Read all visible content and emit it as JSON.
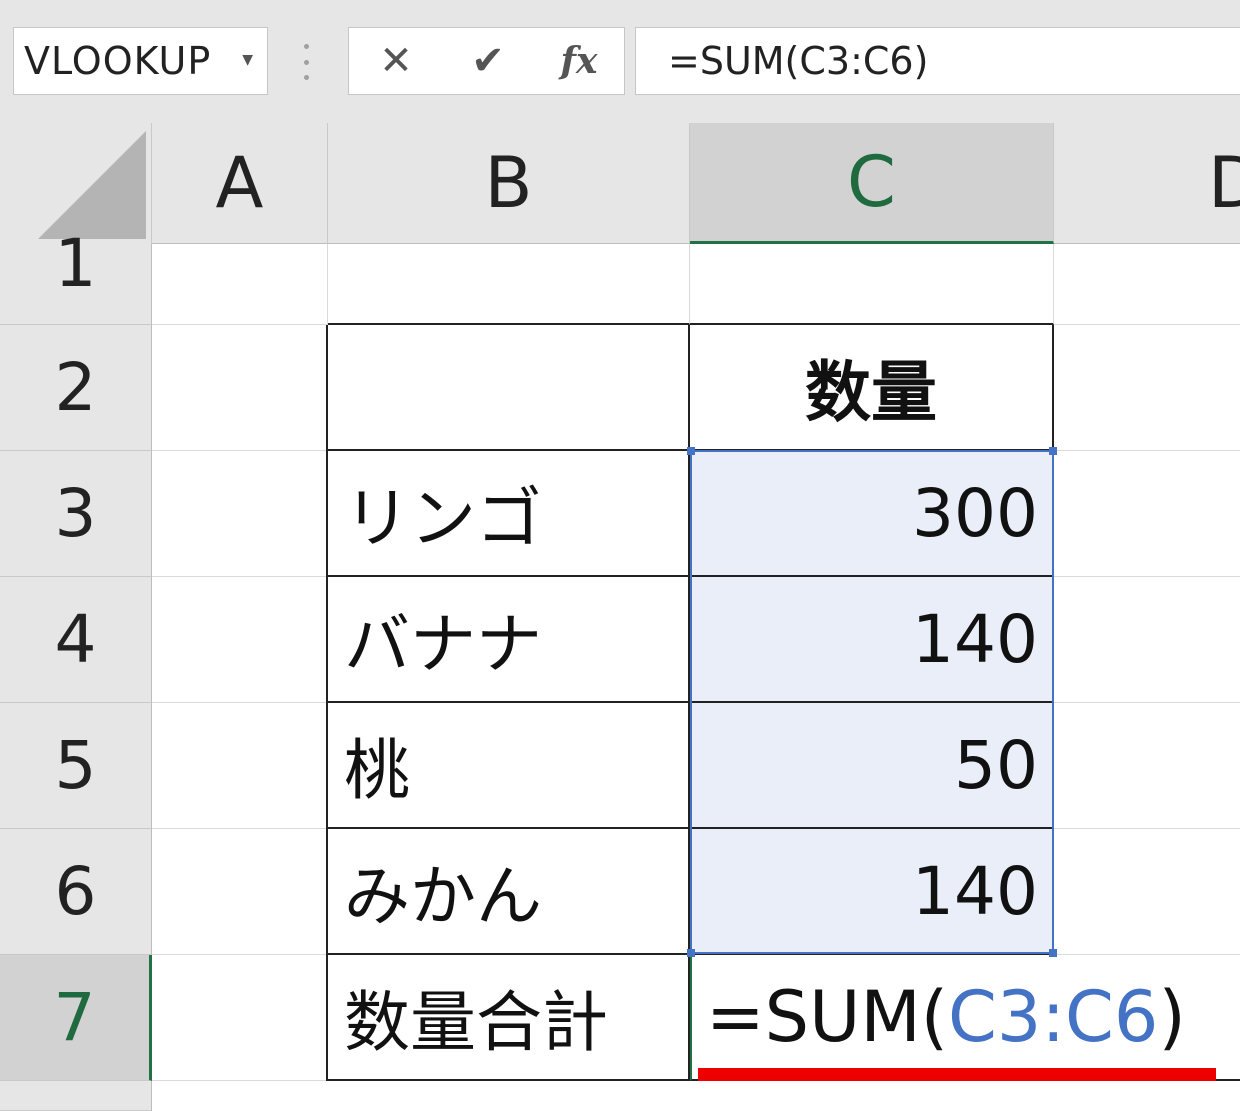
{
  "formula_bar": {
    "name_box": "VLOOKUP",
    "cancel_icon": "✕",
    "enter_icon": "✔",
    "insert_function_label": "fx",
    "formula": "=SUM(C3:C6)"
  },
  "columns": [
    "A",
    "B",
    "C",
    "D"
  ],
  "rows": [
    "1",
    "2",
    "3",
    "4",
    "5",
    "6",
    "7"
  ],
  "table": {
    "header": "数量",
    "items": [
      {
        "label": "リンゴ",
        "value": "300"
      },
      {
        "label": "バナナ",
        "value": "140"
      },
      {
        "label": "桃",
        "value": "50"
      },
      {
        "label": "みかん",
        "value": "140"
      }
    ],
    "total_label": "数量合計",
    "editing": {
      "prefix": "=SUM(",
      "range": "C3:C6",
      "suffix": ")"
    }
  },
  "colors": {
    "selection_green": "#217346",
    "range_blue": "#4472c4",
    "annotation_red": "#ee0000"
  }
}
